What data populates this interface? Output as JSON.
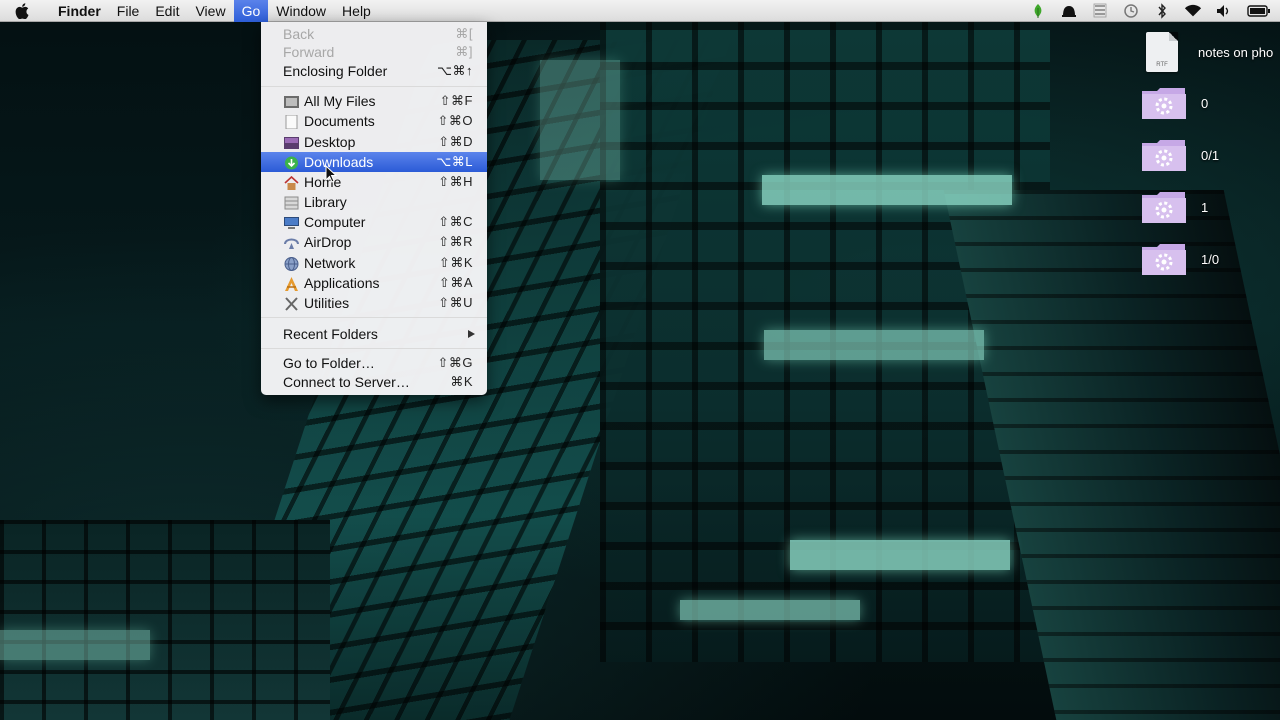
{
  "menubar": {
    "apple_icon": "apple-icon",
    "items": [
      {
        "label": "Finder",
        "bold": true
      },
      {
        "label": "File"
      },
      {
        "label": "Edit"
      },
      {
        "label": "View"
      },
      {
        "label": "Go",
        "active": true
      },
      {
        "label": "Window"
      },
      {
        "label": "Help"
      }
    ],
    "status_icons": [
      "leaf-icon",
      "notification-icon",
      "display-icon",
      "time-machine-icon",
      "bluetooth-icon",
      "wifi-icon",
      "volume-icon",
      "battery-icon"
    ]
  },
  "go_menu": {
    "items": [
      {
        "label": "Back",
        "shortcut": "⌘[",
        "disabled": true
      },
      {
        "label": "Forward",
        "shortcut": "⌘]",
        "disabled": true
      },
      {
        "label": "Enclosing Folder",
        "shortcut": "⌥⌘↑"
      },
      {
        "label": "All My Files",
        "shortcut": "⇧⌘F",
        "icon": "all-my-files-icon"
      },
      {
        "label": "Documents",
        "shortcut": "⇧⌘O",
        "icon": "documents-icon"
      },
      {
        "label": "Desktop",
        "shortcut": "⇧⌘D",
        "icon": "desktop-icon"
      },
      {
        "label": "Downloads",
        "shortcut": "⌥⌘L",
        "icon": "downloads-icon",
        "selected": true
      },
      {
        "label": "Home",
        "shortcut": "⇧⌘H",
        "icon": "home-icon"
      },
      {
        "label": "Library",
        "shortcut": "",
        "icon": "library-icon"
      },
      {
        "label": "Computer",
        "shortcut": "⇧⌘C",
        "icon": "computer-icon"
      },
      {
        "label": "AirDrop",
        "shortcut": "⇧⌘R",
        "icon": "airdrop-icon"
      },
      {
        "label": "Network",
        "shortcut": "⇧⌘K",
        "icon": "network-icon"
      },
      {
        "label": "Applications",
        "shortcut": "⇧⌘A",
        "icon": "applications-icon"
      },
      {
        "label": "Utilities",
        "shortcut": "⇧⌘U",
        "icon": "utilities-icon"
      },
      {
        "label": "Recent Folders",
        "submenu": true
      },
      {
        "label": "Go to Folder…",
        "shortcut": "⇧⌘G"
      },
      {
        "label": "Connect to Server…",
        "shortcut": "⌘K"
      }
    ]
  },
  "desktop": {
    "items": [
      {
        "label": "notes on pho",
        "kind": "file",
        "file_tag": "RTF"
      },
      {
        "label": "0",
        "kind": "folder"
      },
      {
        "label": "0/1",
        "kind": "folder"
      },
      {
        "label": "1",
        "kind": "folder"
      },
      {
        "label": "1/0",
        "kind": "folder"
      }
    ]
  },
  "colors": {
    "selection": "#2d5ed8",
    "folder": "#c6a8e6"
  }
}
